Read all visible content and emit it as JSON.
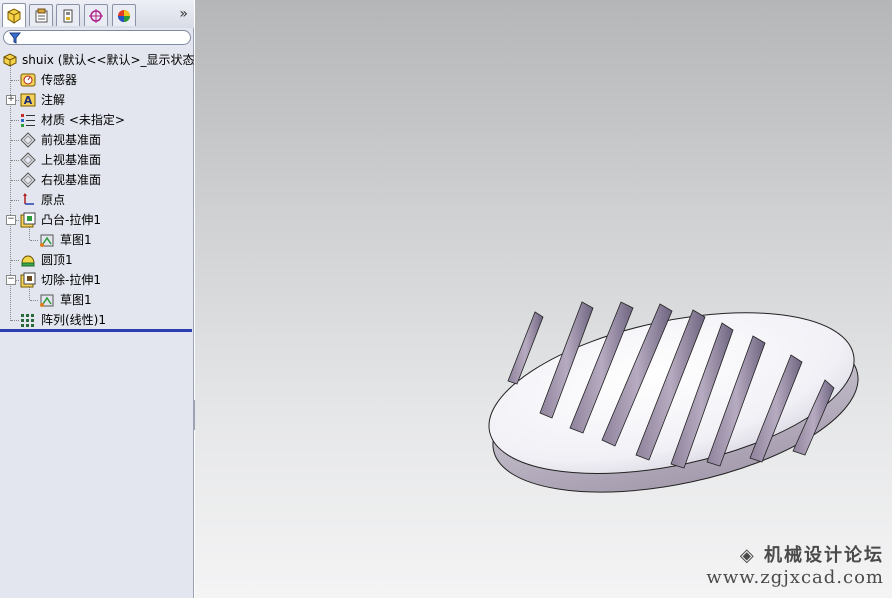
{
  "toolbar": {
    "tabs": [
      {
        "name": "featuremanager-tab",
        "icon": "featuremanager-icon"
      },
      {
        "name": "propertymanager-tab",
        "icon": "propertymanager-icon"
      },
      {
        "name": "configurationmanager-tab",
        "icon": "configurationmanager-icon"
      },
      {
        "name": "dimxpert-tab",
        "icon": "dimxpert-icon"
      },
      {
        "name": "display-manager-tab",
        "icon": "display-manager-icon"
      }
    ],
    "more": "»"
  },
  "filter": {
    "icon": "filter-icon",
    "value": ""
  },
  "tree": {
    "root": "shuix  (默认<<默认>_显示状态",
    "items": [
      {
        "label": "传感器",
        "icon": "sensor-icon"
      },
      {
        "label": "注解",
        "icon": "annotation-icon"
      },
      {
        "label": "材质 <未指定>",
        "icon": "material-icon"
      },
      {
        "label": "前视基准面",
        "icon": "plane-icon"
      },
      {
        "label": "上视基准面",
        "icon": "plane-icon"
      },
      {
        "label": "右视基准面",
        "icon": "plane-icon"
      },
      {
        "label": "原点",
        "icon": "origin-icon"
      },
      {
        "label": "凸台-拉伸1",
        "icon": "boss-extrude-icon"
      },
      {
        "label": "草图1",
        "icon": "sketch-icon"
      },
      {
        "label": "圆顶1",
        "icon": "dome-icon"
      },
      {
        "label": "切除-拉伸1",
        "icon": "cut-extrude-icon"
      },
      {
        "label": "草图1",
        "icon": "sketch-icon"
      },
      {
        "label": "阵列(线性)1",
        "icon": "linear-pattern-icon"
      }
    ]
  },
  "watermark": {
    "line1": "◈ 机械设计论坛",
    "line2": "www.zgjxcad.com"
  },
  "colors": {
    "rollback_bar": "#2b3fb0",
    "model_face": "#f2f2f8",
    "model_slot": "#9a8ea6"
  }
}
